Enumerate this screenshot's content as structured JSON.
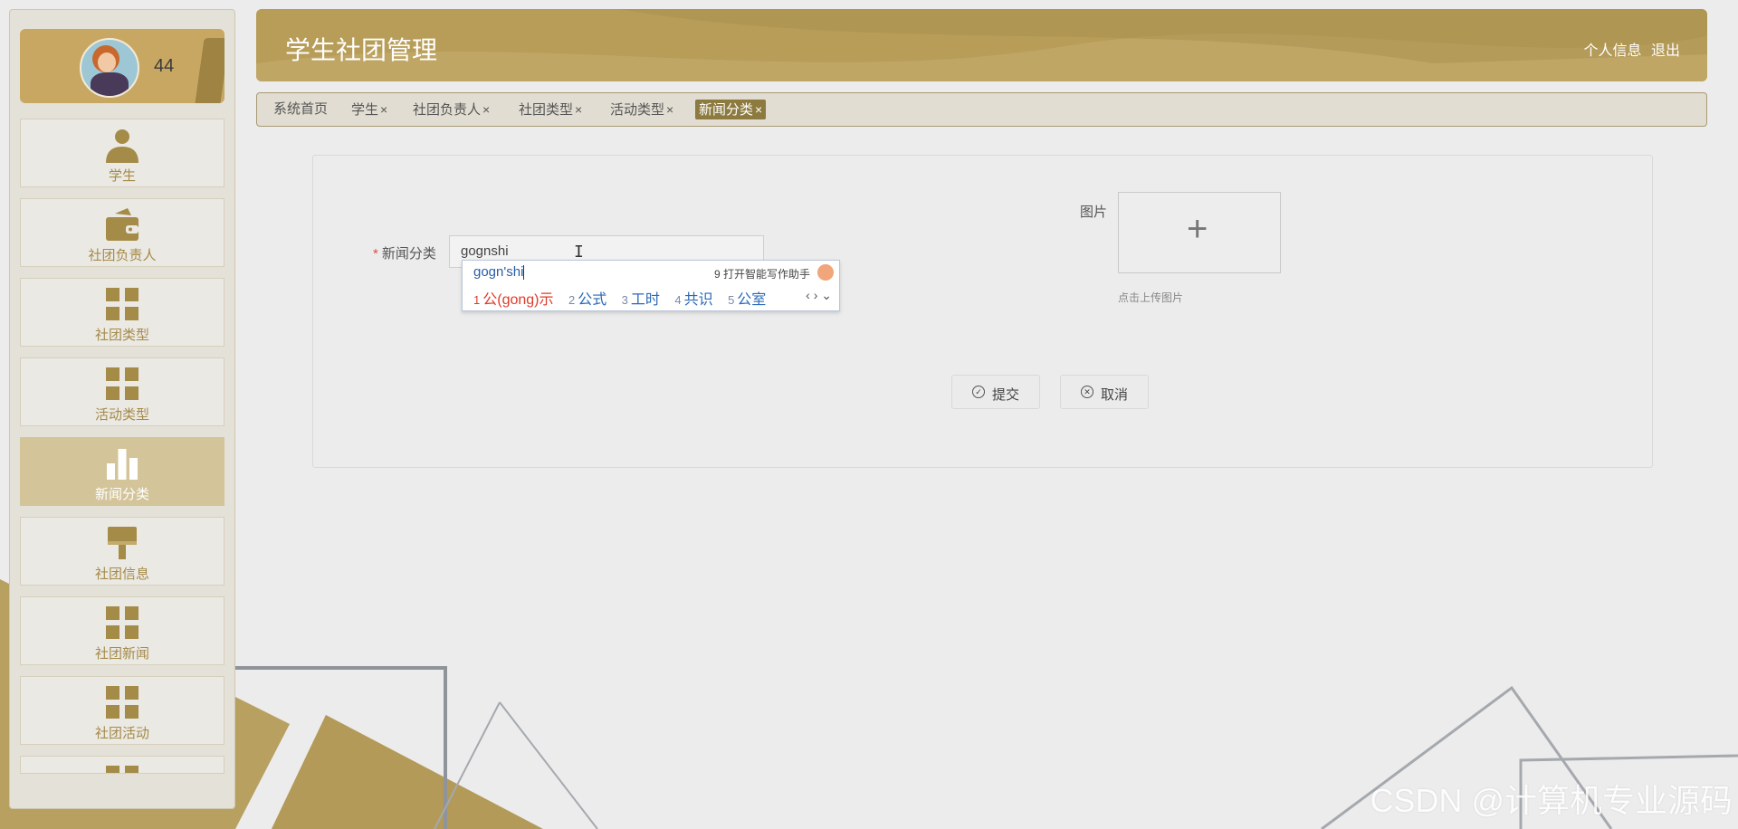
{
  "app": {
    "title": "学生社团管理"
  },
  "header": {
    "profile_link": "个人信息",
    "logout_link": "退出"
  },
  "profile": {
    "number": "44"
  },
  "sidebar": {
    "items": [
      {
        "label": "学生",
        "icon": "user-icon"
      },
      {
        "label": "社团负责人",
        "icon": "wallet-icon"
      },
      {
        "label": "社团类型",
        "icon": "grid-icon"
      },
      {
        "label": "活动类型",
        "icon": "grid-icon"
      },
      {
        "label": "新闻分类",
        "icon": "bar-chart-icon",
        "active": true
      },
      {
        "label": "社团信息",
        "icon": "brush-icon"
      },
      {
        "label": "社团新闻",
        "icon": "grid-icon"
      },
      {
        "label": "社团活动",
        "icon": "grid-icon"
      }
    ]
  },
  "tabs": [
    {
      "label": "系统首页",
      "closable": false
    },
    {
      "label": "学生",
      "closable": true
    },
    {
      "label": "社团负责人",
      "closable": true
    },
    {
      "label": "社团类型",
      "closable": true
    },
    {
      "label": "活动类型",
      "closable": true
    },
    {
      "label": "新闻分类",
      "closable": true,
      "active": true
    }
  ],
  "tab_close_symbol": "×",
  "form": {
    "category_label": "新闻分类",
    "required_mark": "*",
    "category_value": "gognshi",
    "image_label": "图片",
    "upload_plus": "+",
    "upload_hint": "点击上传图片",
    "submit_label": "提交",
    "cancel_label": "取消"
  },
  "ime": {
    "composition": "gogn'shi",
    "assistant": "9 打开智能写作助手",
    "candidates": [
      {
        "n": "1",
        "text": "公(gong)示"
      },
      {
        "n": "2",
        "text": "公式"
      },
      {
        "n": "3",
        "text": "工时"
      },
      {
        "n": "4",
        "text": "共识"
      },
      {
        "n": "5",
        "text": "公室"
      }
    ],
    "nav": "‹ › ⌄"
  },
  "watermark": "CSDN @计算机专业源码",
  "colors": {
    "accent": "#b79d58",
    "accent_dark": "#8c7a3e",
    "sidebar_active": "#d3c49a",
    "label_gold": "#a58b48"
  }
}
